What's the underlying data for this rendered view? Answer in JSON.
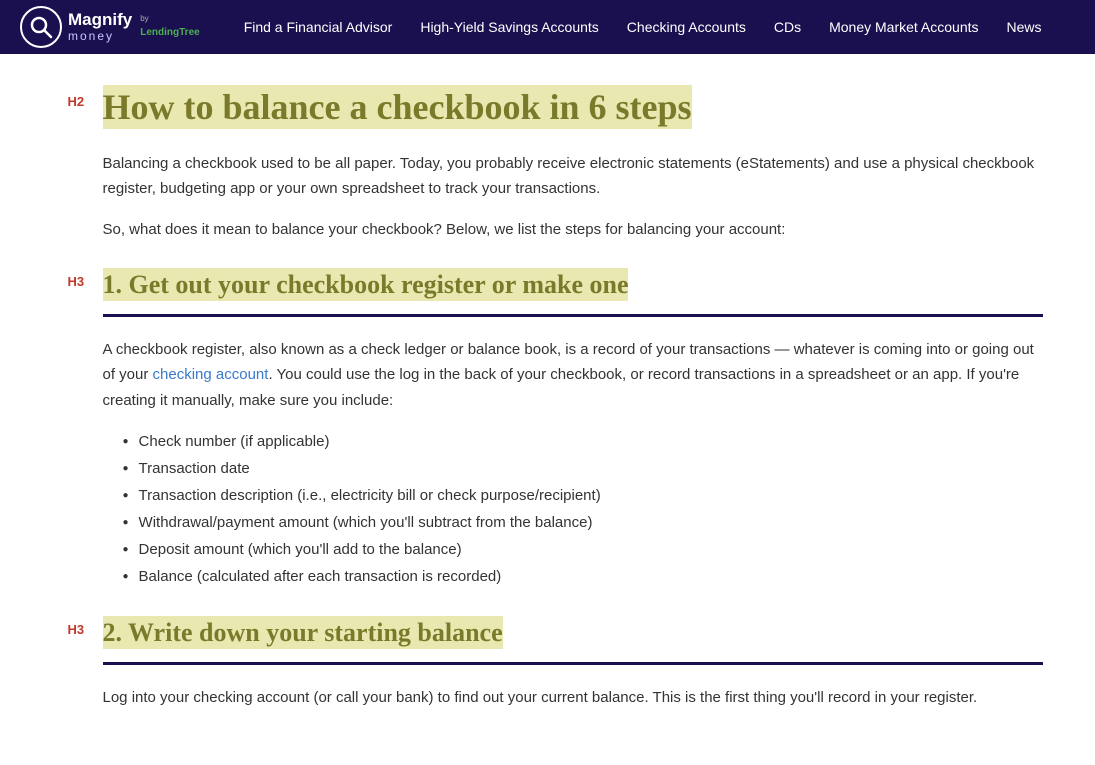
{
  "nav": {
    "logo": {
      "magnify": "Magnify",
      "money": "money",
      "by": "by",
      "lendingtree": "LendingTree"
    },
    "links": [
      {
        "label": "Find a Financial Advisor",
        "href": "#"
      },
      {
        "label": "High-Yield Savings Accounts",
        "href": "#"
      },
      {
        "label": "Checking Accounts",
        "href": "#"
      },
      {
        "label": "CDs",
        "href": "#"
      },
      {
        "label": "Money Market Accounts",
        "href": "#"
      },
      {
        "label": "News",
        "href": "#"
      }
    ]
  },
  "page": {
    "h2_label": "H2",
    "title": "How to balance a checkbook in 6 steps",
    "intro1": "Balancing a checkbook used to be all paper. Today, you probably receive electronic statements (eStatements) and use a physical checkbook register, budgeting app or your own spreadsheet to track your transactions.",
    "intro2": "So, what does it mean to balance your checkbook? Below, we list the steps for balancing your account:",
    "sections": [
      {
        "h3_label": "H3",
        "title": "1. Get out your checkbook register or make one",
        "body1": "A checkbook register, also known as a check ledger or balance book, is a record of your transactions — whatever is coming into or going out of your checking account. You could use the log in the back of your checkbook, or record transactions in a spreadsheet or an app. If you're creating it manually, make sure you include:",
        "link_text": "checking account",
        "link_href": "#",
        "bullets": [
          "Check number (if applicable)",
          "Transaction date",
          "Transaction description (i.e., electricity bill or check purpose/recipient)",
          "Withdrawal/payment amount (which you'll subtract from the balance)",
          "Deposit amount (which you'll add to the balance)",
          "Balance (calculated after each transaction is recorded)"
        ]
      },
      {
        "h3_label": "H3",
        "title": "2. Write down your starting balance",
        "body1": "Log into your checking account (or call your bank) to find out your current balance. This is the first thing you'll record in your register.",
        "bullets": []
      }
    ]
  }
}
